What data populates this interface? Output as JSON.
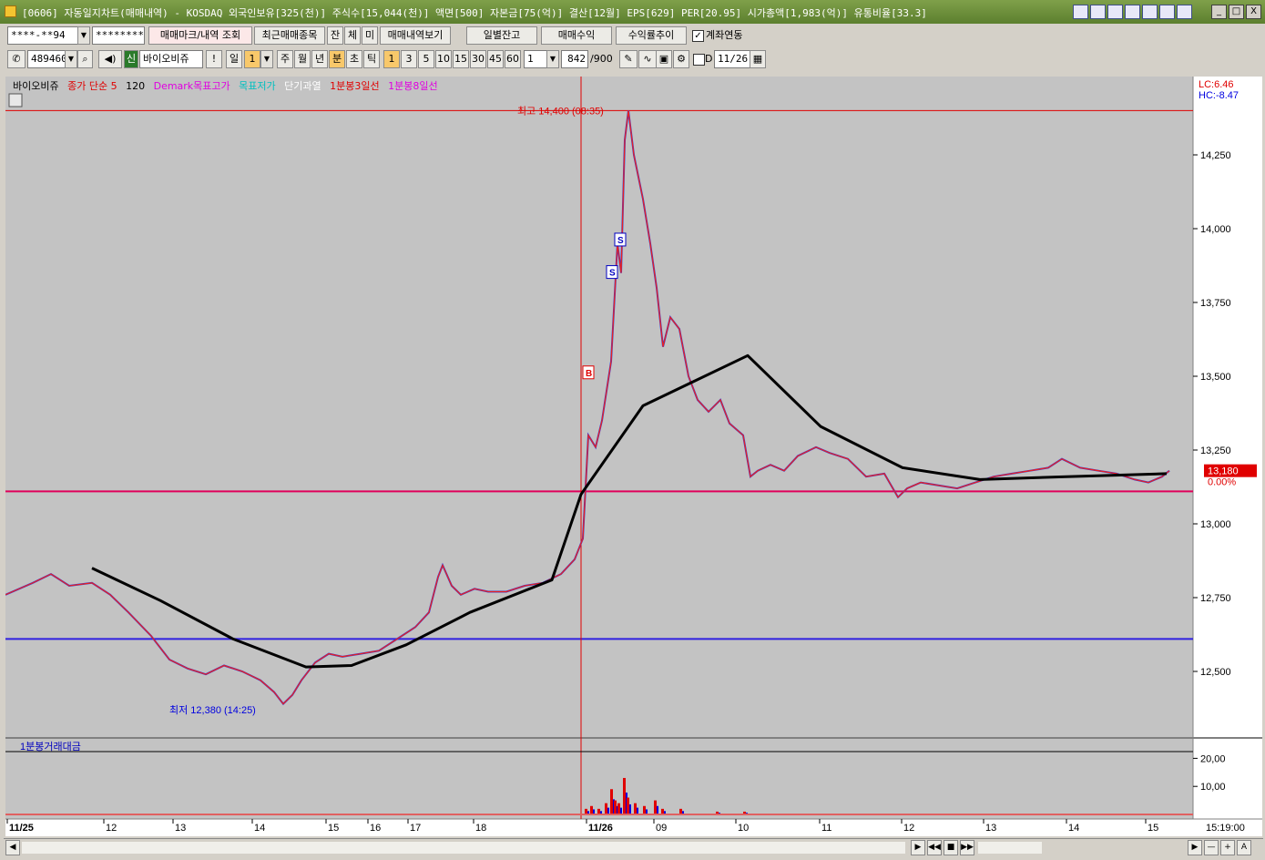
{
  "window": {
    "title": "[0606] 자동일지차트(매매내역) - KOSDAQ 외국인보유[325(천)] 주식수[15,044(천)] 액면[500] 자본금[75(억)] 결산[12월] EPS[629] PER[20.95] 시가총액[1,983(억)] 유통비율[33.3]",
    "controls": [
      "_",
      "□",
      "X"
    ]
  },
  "toolbar1": {
    "account": "****-**94",
    "password": "*********",
    "btn_trade_marks": "매매마크/내역 조회",
    "btn_recent": "최근매매종목",
    "btn_jan": "잔",
    "btn_che": "체",
    "btn_mi": "미",
    "btn_history": "매매내역보기",
    "btn_daily": "일별잔고",
    "btn_profit": "매매수익",
    "btn_return": "수익률추이",
    "link_label": "계좌연동"
  },
  "toolbar2": {
    "code": "489460",
    "shin": "신",
    "stock_name": "바이오비쥬",
    "bang": "!",
    "period_il": "일",
    "period_num": "1",
    "period_ju": "주",
    "period_wol": "월",
    "period_nyeon": "년",
    "period_bun": "분",
    "period_cho": "초",
    "period_tik": "틱",
    "intervals": [
      "1",
      "3",
      "5",
      "10",
      "15",
      "30",
      "45",
      "60"
    ],
    "count": "1",
    "bars": "842",
    "bars_total": "/900",
    "d_label": "D",
    "date": "11/26"
  },
  "chart_data": {
    "type": "line",
    "legend": [
      {
        "text": "바이오비쥬",
        "color": "#000000"
      },
      {
        "text": "종가 단순 5",
        "color": "#e00000"
      },
      {
        "text": "120",
        "color": "#000000"
      },
      {
        "text": "Demark목표고가",
        "color": "#e000e0"
      },
      {
        "text": "목표저가",
        "color": "#00c0c0"
      },
      {
        "text": "단기과열",
        "color": "#ffffff"
      },
      {
        "text": "1분봉3일선",
        "color": "#e00000"
      },
      {
        "text": "1분봉8일선",
        "color": "#e000e0"
      }
    ],
    "lc": "LC:6.46",
    "hc": "HC:-8.47",
    "price_axis": {
      "min": 12250,
      "max": 14500,
      "ticks": [
        "14,250",
        "14,000",
        "13,750",
        "13,500",
        "13,250",
        "13,000",
        "12,750",
        "12,500"
      ],
      "tick_values": [
        14250,
        14000,
        13750,
        13500,
        13250,
        13000,
        12750,
        12500
      ]
    },
    "current_price": "13,180",
    "current_price_value": 13180,
    "current_pct": "0.00%",
    "high_label": "최고 14,400 (08:35)",
    "high_value": 14400,
    "low_label": "최저 12,380 (14:25)",
    "low_value": 12380,
    "ref_line_magenta": 13110,
    "ref_line_blue": 12610,
    "markers": [
      {
        "label": "B",
        "time": "11/26 09:00",
        "price": 13510
      },
      {
        "label": "S",
        "time": "11/26 09:20",
        "price": 13850
      },
      {
        "label": "S",
        "time": "11/26 09:25",
        "price": 13960
      }
    ],
    "time_axis": [
      "11/25",
      "12",
      "13",
      "14",
      "15",
      "16",
      "17",
      "18",
      "11/26",
      "09",
      "10",
      "11",
      "12",
      "13",
      "14",
      "15"
    ],
    "time_axis_bold": [
      "11/25",
      "11/26"
    ],
    "time_right": "15:19:00",
    "ma120_points": [
      {
        "t": "11/25 12:00",
        "v": 12850
      },
      {
        "t": "11/25 13:00",
        "v": 12740
      },
      {
        "t": "11/25 14:00",
        "v": 12610
      },
      {
        "t": "11/25 15:00",
        "v": 12515
      },
      {
        "t": "11/25 16:00",
        "v": 12520
      },
      {
        "t": "11/25 17:00",
        "v": 12590
      },
      {
        "t": "11/25 18:00",
        "v": 12700
      },
      {
        "t": "11/25 19:40",
        "v": 12810
      },
      {
        "t": "11/26 09:00",
        "v": 13100
      },
      {
        "t": "11/26 09:40",
        "v": 13400
      },
      {
        "t": "11/26 10:10",
        "v": 13570
      },
      {
        "t": "11/26 11:00",
        "v": 13330
      },
      {
        "t": "11/26 12:00",
        "v": 13190
      },
      {
        "t": "11/26 13:00",
        "v": 13150
      },
      {
        "t": "11/26 14:00",
        "v": 13160
      },
      {
        "t": "11/26 15:15",
        "v": 13170
      }
    ],
    "volume_panel": {
      "title": "1분봉거래대금",
      "ticks": [
        "20,00",
        "10,00"
      ],
      "tick_values": [
        20,
        10
      ],
      "max": 25
    }
  },
  "scrollbar": {
    "left_arrow": "◀",
    "right_arrow": "▶",
    "controls": [
      "▶",
      "◀◀",
      "■",
      "▶▶",
      "—",
      "+",
      "A"
    ]
  }
}
